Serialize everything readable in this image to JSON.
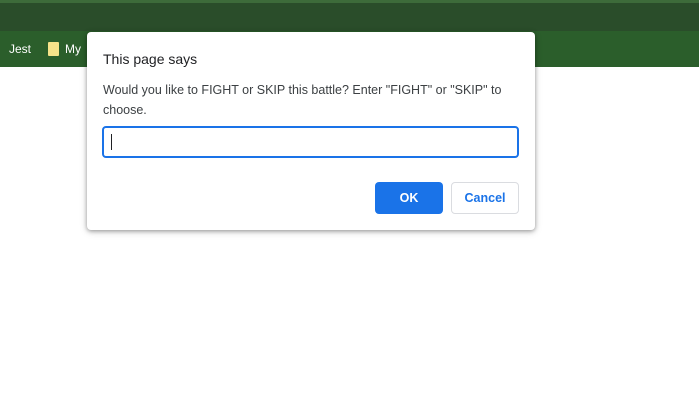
{
  "browser": {
    "bookmarks": [
      {
        "label": "Jest",
        "icon": null
      },
      {
        "label": "My",
        "icon": "folder-icon"
      }
    ]
  },
  "dialog": {
    "title": "This page says",
    "message": "Would you like to FIGHT or SKIP this battle? Enter \"FIGHT\" or \"SKIP\" to choose.",
    "input_value": "",
    "ok_label": "OK",
    "cancel_label": "Cancel"
  },
  "colors": {
    "topbar": "#2a4d2a",
    "bookmarks_bar": "#2b5e2b",
    "accent": "#1a73e8"
  }
}
